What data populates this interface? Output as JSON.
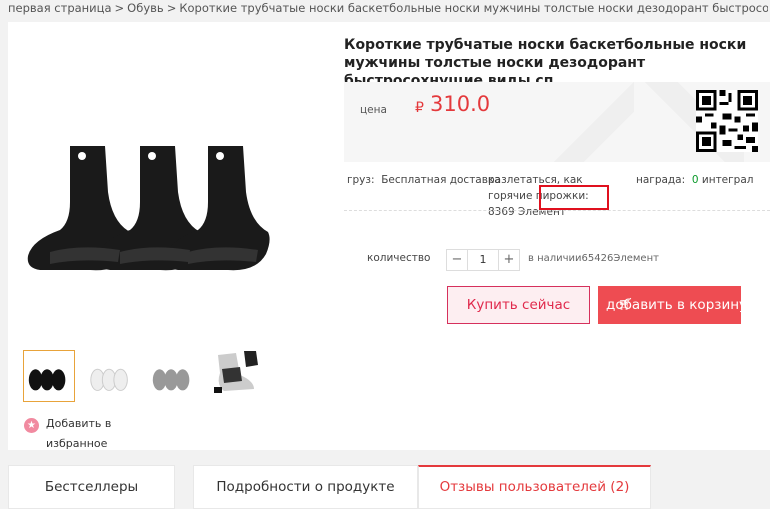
{
  "breadcrumb": {
    "home": "первая страница",
    "category": "Обувь",
    "current": "Короткие трубчатые носки баскетбольные носки мужчины толстые носки дезодорант быстросохнущие виды сп",
    "separator": ">"
  },
  "product": {
    "title": "Короткие трубчатые носки баскетбольные носки мужчины толстые носки дезодорант быстросохнущие виды сп",
    "price_label": "цена",
    "currency": "₽",
    "price": "310.0",
    "shipping_label": "груз:",
    "shipping_value": "Бесплатная доставка",
    "popular_label": "разлетаться, как горячие пирожки:",
    "popular_value": "8369 Элемент",
    "reward_label": "награда:",
    "reward_value": "0",
    "reward_unit": "интеграл",
    "qty_label": "количество",
    "qty_value": "1",
    "qty_minus": "−",
    "qty_plus": "+",
    "stock_text": "в наличии65426Элемент",
    "buy_now": "Купить сейчас",
    "add_to_cart": "добавить в корзину",
    "favorite": "Добавить в избранное"
  },
  "tabs": [
    {
      "label": "Бестселлеры"
    },
    {
      "label": "Подробности о продукте"
    },
    {
      "label": "Отзывы пользователей (2)"
    }
  ],
  "colors": {
    "accent": "#e4393c",
    "cart_button": "#ee4c52",
    "buy_border": "#d6305c",
    "highlight": "#e0101e",
    "green": "#0a9a2a"
  },
  "icons": {
    "favorite": "star-icon",
    "cart": "cart-icon",
    "qr": "qr-code-icon"
  }
}
